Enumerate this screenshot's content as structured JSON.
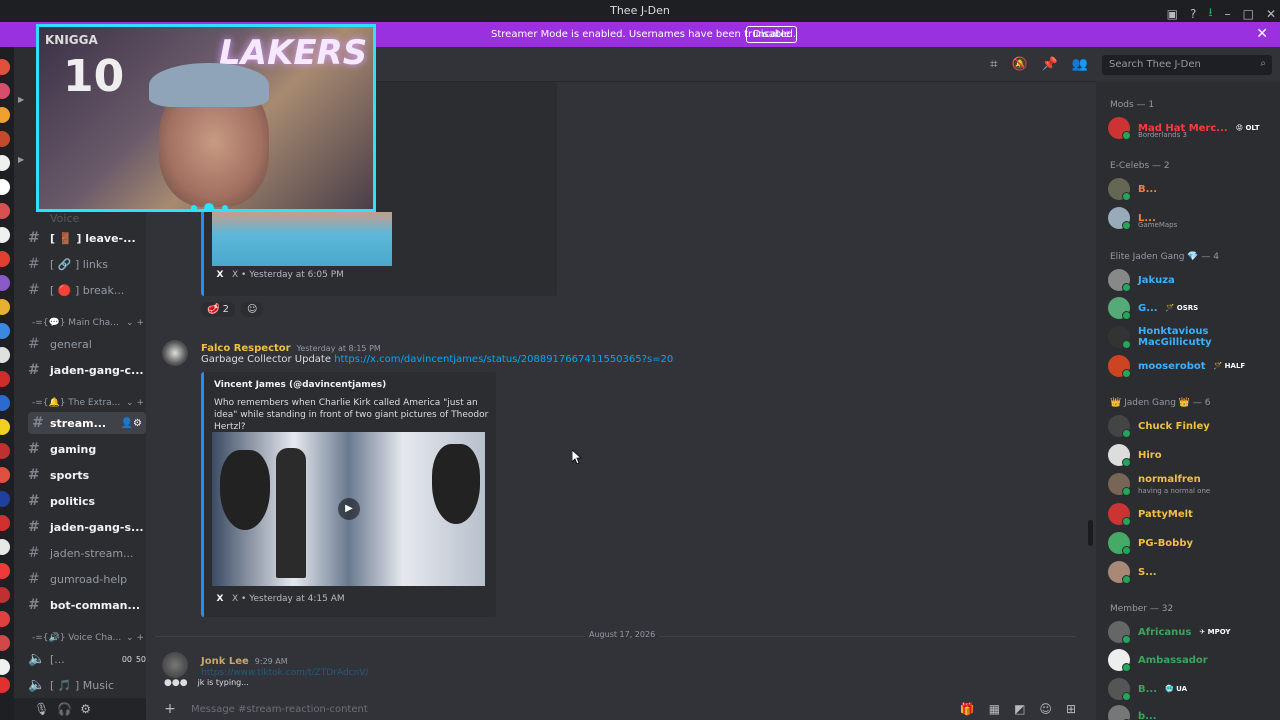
{
  "window": {
    "title": "Thee J-Den"
  },
  "banner": {
    "message": "Streamer Mode is enabled. Usernames have been truncated.",
    "disable_label": "Disable"
  },
  "search": {
    "placeholder": "Search Thee J-Den"
  },
  "webcam": {
    "jersey_name": "KNIGGA",
    "jersey_number": "10",
    "sign_text": "LAKERS"
  },
  "channels": {
    "top_faded": "Voice",
    "items_top": [
      {
        "icon": "#",
        "label": "[ 🚪 ] leave-..."
      },
      {
        "icon": "#",
        "label": "[ 🔗 ] links"
      },
      {
        "icon": "#",
        "label": "[ 🔴 ] break..."
      }
    ],
    "cat_main": "-={💬} Main Cha...",
    "main_items": [
      {
        "icon": "#",
        "label": "general"
      },
      {
        "icon": "#",
        "label": "jaden-gang-c..."
      }
    ],
    "cat_extra": "-={🔔} The Extra...",
    "extra_items": [
      {
        "icon": "#",
        "label": "stream..."
      },
      {
        "icon": "#",
        "label": "gaming"
      },
      {
        "icon": "#",
        "label": "sports"
      },
      {
        "icon": "#",
        "label": "politics"
      },
      {
        "icon": "#",
        "label": "jaden-gang-s..."
      },
      {
        "icon": "#",
        "label": "jaden-stream..."
      },
      {
        "icon": "#",
        "label": "gumroad-help"
      },
      {
        "icon": "#",
        "label": "bot-comman..."
      }
    ],
    "cat_voice": "-={🔊} Voice Cha...",
    "voice_items": [
      {
        "label": "[...",
        "count_a": "00",
        "count_b": "50"
      },
      {
        "label": "[ 🎵 ] Music"
      }
    ]
  },
  "messages": {
    "embed1_footer": "X • Yesterday at 6:05 PM",
    "reaction_count": "2",
    "msg2": {
      "author": "Falco Respector",
      "time": "Yesterday at 8:15 PM",
      "text": "Garbage Collector Update ",
      "link": "https://x.com/davincentjames/status/2088917667411550365?s=20",
      "embed_author": "Vincent James (@davincentjames)",
      "embed_text": "Who remembers when Charlie Kirk called America \"just an idea\" while standing in front of two giant pictures of Theodor Hertzl?",
      "embed_footer": "X • Yesterday at 4:15 AM"
    },
    "divider_date": "August 17, 2026",
    "msg3": {
      "author": "Jonk Lee",
      "time": "9:29 AM",
      "text": "https://www.tiktok.com/t/ZTDrAdcnV/"
    },
    "typing": "jk is typing...",
    "composer_placeholder": "Message #stream-reaction-content"
  },
  "members": {
    "groups": [
      {
        "title": "Mods — 1"
      },
      {
        "title": "E-Celebs — 2"
      },
      {
        "title": "Elite Jaden Gang 💎 — 4"
      },
      {
        "title": "👑 Jaden Gang 👑 — 6"
      },
      {
        "title": "Member — 32"
      }
    ],
    "mods": [
      {
        "name": "Mad Hat Merc...",
        "sub": "Borderlands 3",
        "tag": "😡 OLT",
        "color": "#ff3b3b"
      }
    ],
    "ecelebs": [
      {
        "name": "B...",
        "color": "#ff7d3b"
      },
      {
        "name": "L...",
        "sub": "GameMaps",
        "color": "#ff7d3b"
      }
    ],
    "elite": [
      {
        "name": "Jakuza",
        "color": "#3bb0ff"
      },
      {
        "name": "G...",
        "tag": "🪄 OSRS",
        "color": "#3bb0ff"
      },
      {
        "name": "Honktavious MacGillicutty",
        "color": "#3bb0ff"
      },
      {
        "name": "mooserobot",
        "tag": "🪄 HALF",
        "color": "#3bb0ff"
      }
    ],
    "gang": [
      {
        "name": "Chuck Finley",
        "color": "#f0c040"
      },
      {
        "name": "Hiro",
        "color": "#f0c040"
      },
      {
        "name": "normalfren",
        "sub": "having a normal one",
        "color": "#f0c040"
      },
      {
        "name": "PattyMelt",
        "color": "#f0c040"
      },
      {
        "name": "PG-Bobby",
        "color": "#f0c040"
      },
      {
        "name": "S...",
        "color": "#f0c040"
      }
    ],
    "members": [
      {
        "name": "Africanus",
        "tag": "✈ MPOY",
        "color": "#3ba55c"
      },
      {
        "name": "Ambassador",
        "color": "#3ba55c"
      },
      {
        "name": "B...",
        "tag": "🥶 UA",
        "color": "#3ba55c"
      },
      {
        "name": "b...",
        "color": "#3ba55c"
      }
    ]
  }
}
